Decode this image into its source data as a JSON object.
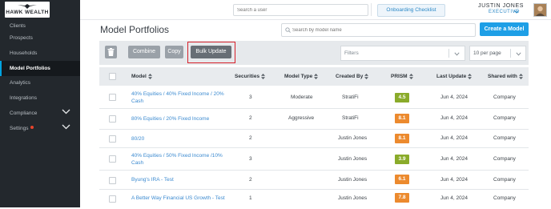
{
  "brand": {
    "logo_text": "HAWK WEALTH"
  },
  "sidebar": {
    "items": [
      {
        "label": "Clients"
      },
      {
        "label": "Prospects"
      },
      {
        "label": "Households"
      },
      {
        "label": "Model Portfolios",
        "active": true
      },
      {
        "label": "Analytics"
      },
      {
        "label": "Integrations"
      },
      {
        "label": "Compliance",
        "expandable": true
      },
      {
        "label": "Settings",
        "expandable": true,
        "notification": true
      }
    ]
  },
  "topbar": {
    "search_placeholder": "Search a user",
    "onboarding_label": "Onboarding Checklist",
    "user_name": "JUSTIN JONES",
    "user_role": "EXECUTIVE"
  },
  "page": {
    "title": "Model Portfolios",
    "search_placeholder": "Search by model name",
    "create_label": "Create a Model"
  },
  "toolbar": {
    "combine_label": "Combine",
    "copy_label": "Copy",
    "bulk_update_label": "Bulk Update",
    "filters_placeholder": "Filters",
    "per_page_value": "10 per page"
  },
  "table": {
    "columns": [
      "Model",
      "Securities",
      "Model Type",
      "Created By",
      "PRISM",
      "Last Update",
      "Shared with"
    ],
    "rows": [
      {
        "model": "40% Equities / 40% Fixed Income / 20% Cash",
        "securities": "3",
        "model_type": "Moderate",
        "created_by": "StratiFi",
        "prism": "4.5",
        "prism_color": "#8aab2a",
        "last_update": "Jun 4, 2024",
        "shared_with": "Company"
      },
      {
        "model": "80% Equities / 20% Fixed Income",
        "securities": "2",
        "model_type": "Aggressive",
        "created_by": "StratiFi",
        "prism": "8.1",
        "prism_color": "#ec8a2e",
        "last_update": "Jun 4, 2024",
        "shared_with": "Company"
      },
      {
        "model": "80/20",
        "securities": "2",
        "model_type": "",
        "created_by": "Justin Jones",
        "prism": "8.1",
        "prism_color": "#ec8a2e",
        "last_update": "Jun 4, 2024",
        "shared_with": "Company"
      },
      {
        "model": "40% Equities / 50% Fixed Income /10% Cash",
        "securities": "3",
        "model_type": "",
        "created_by": "Justin Jones",
        "prism": "3.9",
        "prism_color": "#8aab2a",
        "last_update": "Jun 4, 2024",
        "shared_with": "Company"
      },
      {
        "model": "Byung's IRA - Test",
        "securities": "2",
        "model_type": "",
        "created_by": "Justin Jones",
        "prism": "6.1",
        "prism_color": "#ec8a2e",
        "last_update": "Jun 4, 2024",
        "shared_with": "Company"
      },
      {
        "model": "A Better Way Financial US Growth - Test",
        "securities": "1",
        "model_type": "",
        "created_by": "Justin Jones",
        "prism": "7.8",
        "prism_color": "#ec8a2e",
        "last_update": "Jun 4, 2024",
        "shared_with": "Company"
      }
    ]
  }
}
